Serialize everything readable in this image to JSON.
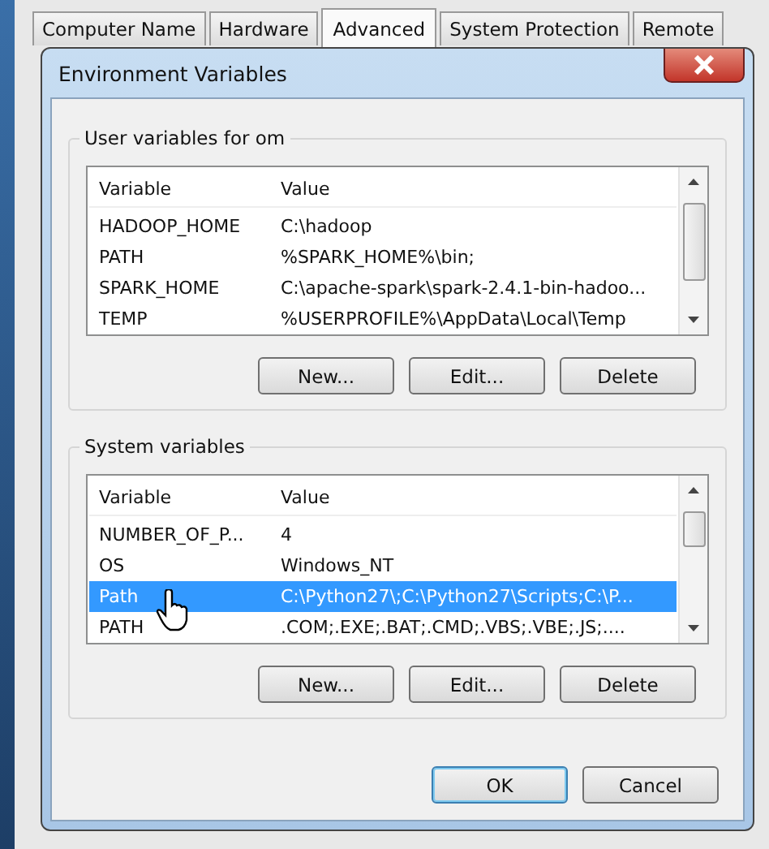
{
  "tabs": [
    {
      "label": "Computer Name",
      "selected": false
    },
    {
      "label": "Hardware",
      "selected": false
    },
    {
      "label": "Advanced",
      "selected": true
    },
    {
      "label": "System Protection",
      "selected": false
    },
    {
      "label": "Remote",
      "selected": false
    }
  ],
  "dialog": {
    "title": "Environment Variables"
  },
  "groups": [
    {
      "legend": "User variables for om",
      "columns": [
        "Variable",
        "Value"
      ],
      "rows": [
        {
          "variable": "HADOOP_HOME",
          "value": "C:\\hadoop",
          "selected": false
        },
        {
          "variable": "PATH",
          "value": "%SPARK_HOME%\\bin;",
          "selected": false
        },
        {
          "variable": "SPARK_HOME",
          "value": "C:\\apache-spark\\spark-2.4.1-bin-hadoo...",
          "selected": false
        },
        {
          "variable": "TEMP",
          "value": "%USERPROFILE%\\AppData\\Local\\Temp",
          "selected": false
        }
      ],
      "buttons": [
        "New...",
        "Edit...",
        "Delete"
      ]
    },
    {
      "legend": "System variables",
      "columns": [
        "Variable",
        "Value"
      ],
      "rows": [
        {
          "variable": "NUMBER_OF_P...",
          "value": "4",
          "selected": false
        },
        {
          "variable": "OS",
          "value": "Windows_NT",
          "selected": false
        },
        {
          "variable": "Path",
          "value": "C:\\Python27\\;C:\\Python27\\Scripts;C:\\P...",
          "selected": true
        },
        {
          "variable": "PATH",
          "value": ".COM;.EXE;.BAT;.CMD;.VBS;.VBE;.JS;....",
          "selected": false
        }
      ],
      "buttons": [
        "New...",
        "Edit...",
        "Delete"
      ]
    }
  ],
  "buttons": [
    {
      "label": "OK",
      "default": true
    },
    {
      "label": "Cancel",
      "default": false
    }
  ]
}
